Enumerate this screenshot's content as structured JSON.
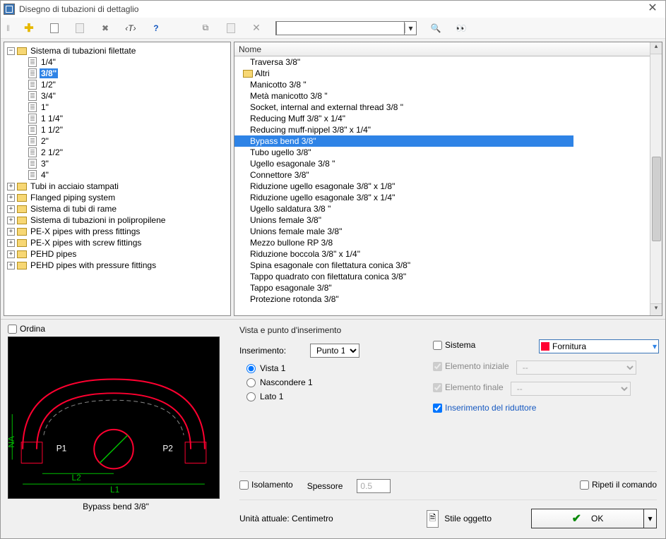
{
  "window": {
    "title": "Disegno di tubazioni di dettaglio"
  },
  "toolbar": {
    "search_placeholder": ""
  },
  "tree": {
    "root": "Sistema di tubazioni filettate",
    "sizes": [
      "1/4\"",
      "3/8\"",
      "1/2\"",
      "3/4\"",
      "1\"",
      "1 1/4\"",
      "1 1/2\"",
      "2\"",
      "2 1/2\"",
      "3\"",
      "4\""
    ],
    "selected": "3/8\"",
    "siblings": [
      "Tubi in acciaio stampati",
      "Flanged piping system",
      "Sistema di tubi di rame",
      "Sistema di tubazioni in polipropilene",
      "PE-X pipes with press fittings",
      "PE-X pipes with screw fittings",
      "PEHD pipes",
      "PEHD pipes with pressure fittings"
    ]
  },
  "list": {
    "header": "Nome",
    "lead_item": "Traversa 3/8\"",
    "group": "Altri",
    "items": [
      "Manicotto 3/8 \"",
      "Metà manicotto 3/8 \"",
      "Socket, internal and external thread 3/8 \"",
      "Reducing Muff 3/8\" x 1/4\"",
      "Reducing muff-nippel 3/8\" x 1/4\"",
      "Bypass bend 3/8\"",
      "Tubo ugello 3/8\"",
      "Ugello esagonale 3/8 \"",
      "Connettore 3/8\"",
      "Riduzione ugello esagonale 3/8\" x 1/8\"",
      "Riduzione ugello esagonale 3/8\" x 1/4\"",
      "Ugello saldatura 3/8 \"",
      "Unions female 3/8\"",
      "Unions female male 3/8\"",
      "Mezzo bullone RP 3/8",
      "Riduzione boccola 3/8\" x 1/4\"",
      "Spina esagonale con filettatura conica 3/8\"",
      "Tappo quadrato con filettatura conica 3/8\"",
      "Tappo esagonale 3/8\"",
      "Protezione rotonda 3/8\""
    ],
    "selected_index": 5
  },
  "sort": {
    "label": "Ordina"
  },
  "preview": {
    "caption": "Bypass bend 3/8\"",
    "p1": "P1",
    "p2": "P2",
    "l1": "L1",
    "l2": "L2",
    "na": "NA"
  },
  "options": {
    "section": "Vista e punto d'inserimento",
    "ins_label": "Inserimento:",
    "ins_value": "Punto 1",
    "view1": "Vista 1",
    "hide1": "Nascondere 1",
    "side1": "Lato 1",
    "system_label": "Sistema",
    "layer_value": "Fornitura",
    "elem_init": "Elemento iniziale",
    "elem_fin": "Elemento finale",
    "placeholder_sel": "--",
    "ins_red": "Inserimento del riduttore",
    "iso": "Isolamento",
    "thick_label": "Spessore",
    "thick_value": "0.5",
    "repeat": "Ripeti il comando",
    "unit_label": "Unità attuale: Centimetro",
    "style_btn": "Stile oggetto",
    "ok": "OK"
  }
}
